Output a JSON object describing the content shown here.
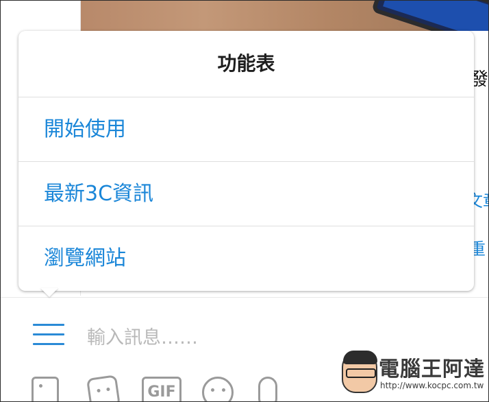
{
  "menu": {
    "title": "功能表",
    "items": [
      {
        "label": "開始使用"
      },
      {
        "label": "最新3C資訊"
      },
      {
        "label": "瀏覽網站"
      }
    ]
  },
  "background": {
    "peek_texts": [
      "發",
      "文章",
      "重"
    ]
  },
  "input_bar": {
    "placeholder": "輸入訊息……"
  },
  "toolbar": {
    "gif_label": "GIF",
    "icons": [
      "image-icon",
      "sticker-icon",
      "gif-icon",
      "emoji-icon",
      "microphone-icon"
    ]
  },
  "watermark": {
    "text": "電腦王阿達",
    "url": "http://www.kocpc.com.tw"
  },
  "colors": {
    "accent": "#1a86d8",
    "title": "#1e1e1e",
    "divider": "#dedede",
    "icon_gray": "#9a9a9a"
  }
}
